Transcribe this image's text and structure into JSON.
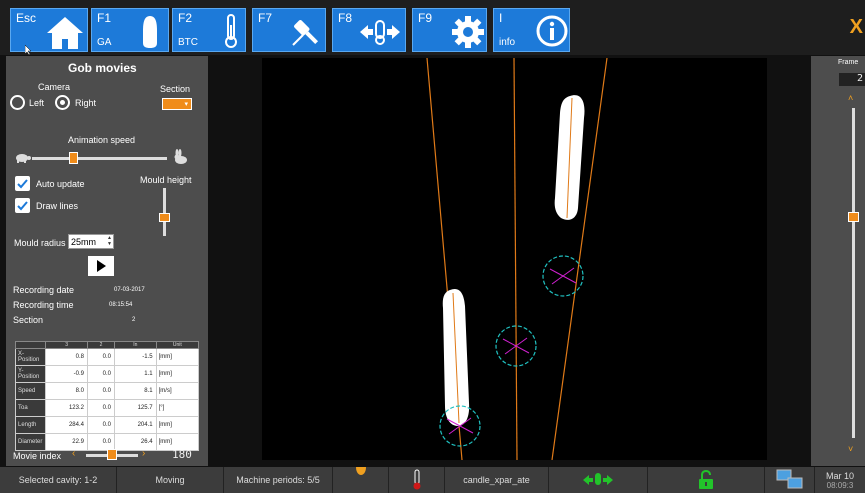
{
  "toolbar": {
    "esc_label": "Esc",
    "f1_label": "F1",
    "f1_sub": "GA",
    "f2_label": "F2",
    "f2_sub": "BTC",
    "f7_label": "F7",
    "f8_label": "F8",
    "f9_label": "F9",
    "info_label": "I",
    "info_sub": "info",
    "close_label": "X",
    "icons": [
      "home-icon",
      "gob-icon",
      "thermometer-icon",
      "swab-icon",
      "move-icon",
      "gear-icon",
      "info-icon"
    ]
  },
  "panel": {
    "title": "Gob movies",
    "camera_label": "Camera",
    "left_label": "Left",
    "right_label": "Right",
    "camera_selected": "Right",
    "section_label": "Section",
    "animation_speed_label": "Animation speed",
    "animation_speed_level": 0.3,
    "auto_update_label": "Auto update",
    "auto_update_checked": true,
    "draw_lines_label": "Draw lines",
    "draw_lines_checked": true,
    "mould_height_label": "Mould height",
    "mould_height_level": 0.4,
    "mould_radius_label": "Mould radius",
    "mould_radius_value": "25mm",
    "recording_date_label": "Recording date",
    "recording_date_value": "07-03-2017",
    "recording_time_label": "Recording time",
    "recording_time_value": "08:15:54",
    "section_row_label": "Section",
    "section_row_value": "2",
    "movie_index_label": "Movie index",
    "movie_index_value": "180",
    "movie_index_level": 0.5
  },
  "table": {
    "headers": [
      "",
      "3",
      "2",
      "In",
      "Unit"
    ],
    "rows": [
      [
        "X-Position",
        "0.8",
        "0.0",
        "-1.5",
        "[mm]"
      ],
      [
        "Y-Position",
        "-0.9",
        "0.0",
        "1.1",
        "[mm]"
      ],
      [
        "Speed",
        "8.0",
        "0.0",
        "8.1",
        "[m/s]"
      ],
      [
        "Toa",
        "123.2",
        "0.0",
        "125.7",
        "[°]"
      ],
      [
        "Length",
        "284.4",
        "0.0",
        "204.1",
        "[mm]"
      ],
      [
        "Diameter",
        "22.9",
        "0.0",
        "26.4",
        "[mm]"
      ]
    ]
  },
  "right": {
    "frame_label": "Frame",
    "frame_value": "2",
    "frame_level": 0.33
  },
  "status": {
    "selected_cavity": "Selected cavity: 1-2",
    "moving": "Moving",
    "machine_periods": "Machine periods: 5/5",
    "swab_file": "candle_xpar_ate",
    "date": "Mar 10",
    "time": "08:09:3"
  },
  "colors": {
    "accent_blue": "#1d7ad9",
    "accent_orange": "#f0a020",
    "lock_green": "#22c42a",
    "trajectory": "#e07a18",
    "circle_cyan": "#20c0c0",
    "cross_magenta": "#d020d0"
  }
}
